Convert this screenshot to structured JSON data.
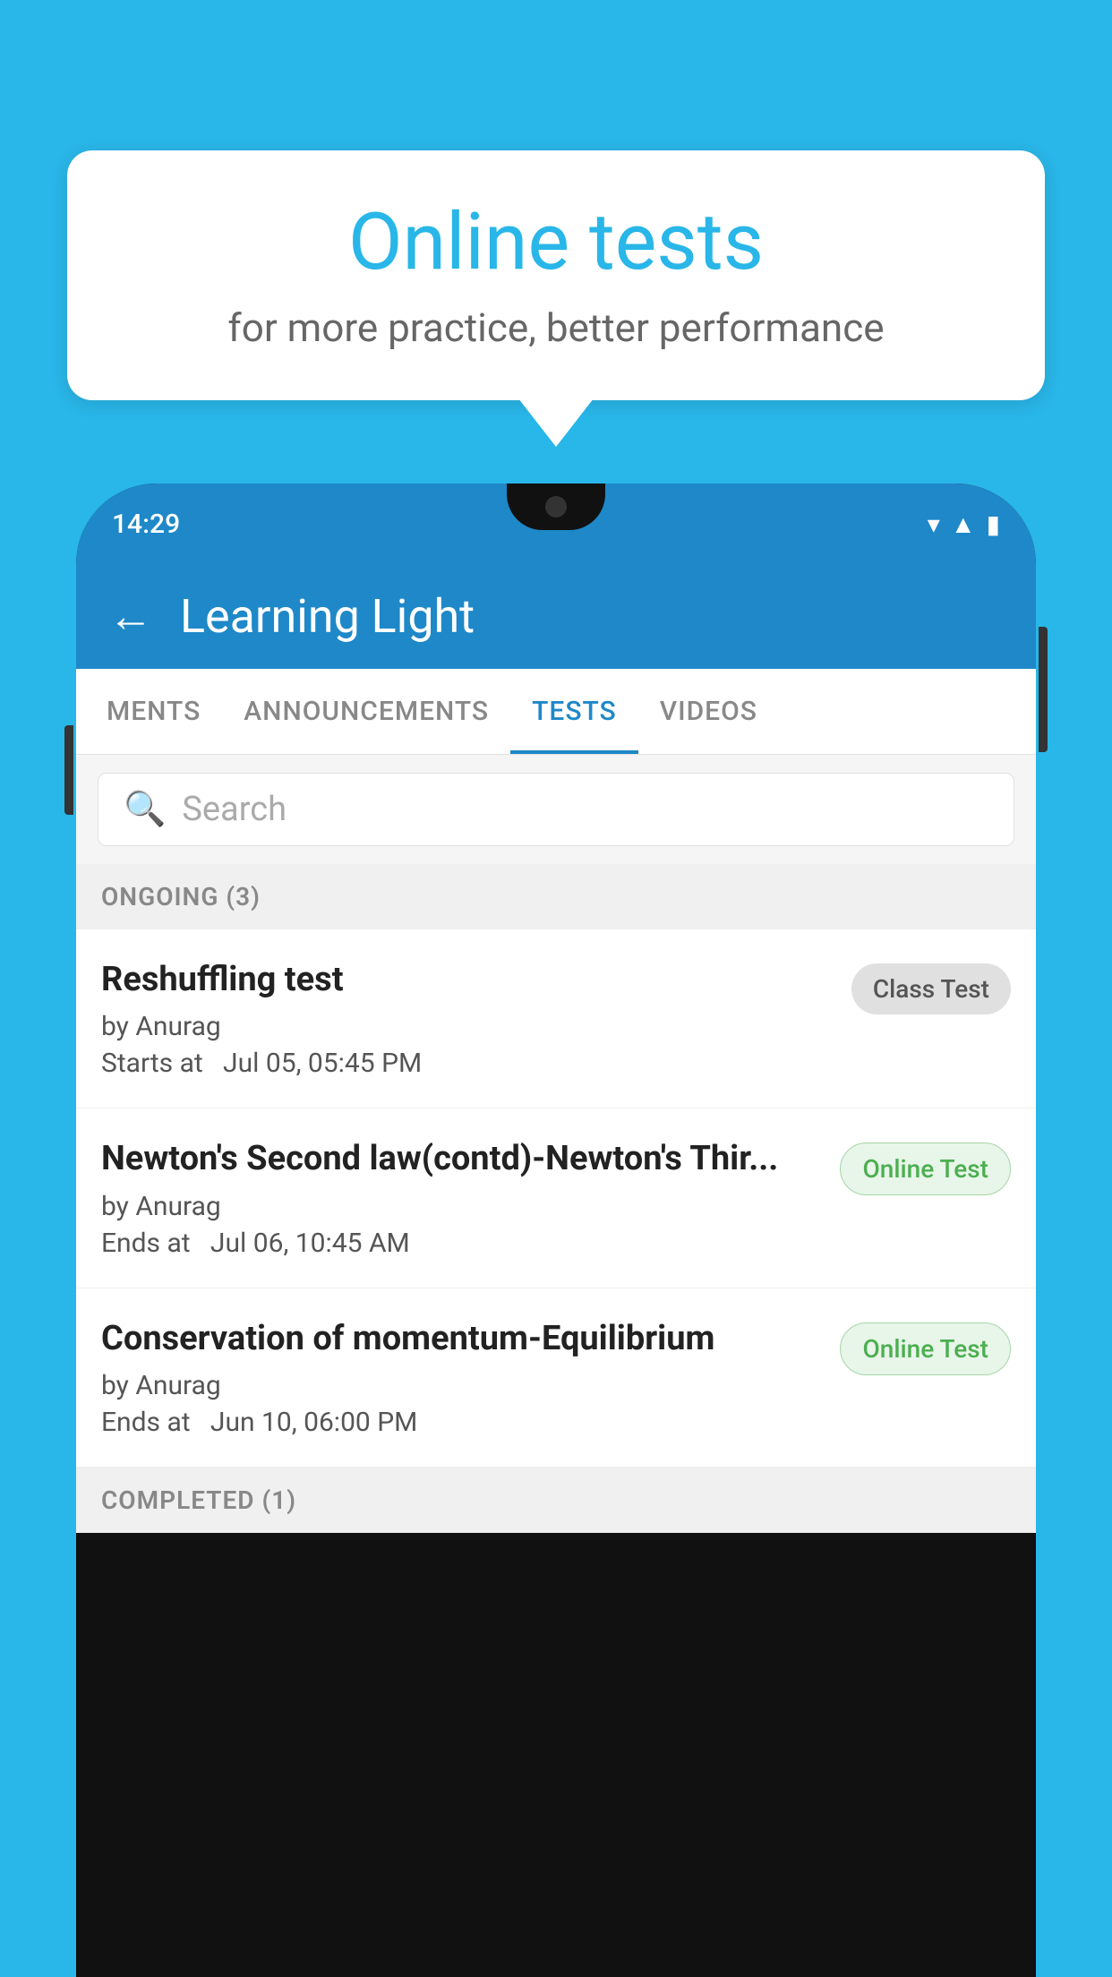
{
  "background_color": "#29b6e8",
  "speech_bubble": {
    "title": "Online tests",
    "subtitle": "for more practice, better performance"
  },
  "phone": {
    "status_bar": {
      "time": "14:29",
      "icons": [
        "wifi",
        "signal",
        "battery"
      ]
    },
    "app_header": {
      "title": "Learning Light",
      "back_label": "←"
    },
    "tabs": [
      {
        "label": "MENTS",
        "active": false
      },
      {
        "label": "ANNOUNCEMENTS",
        "active": false
      },
      {
        "label": "TESTS",
        "active": true
      },
      {
        "label": "VIDEOS",
        "active": false
      }
    ],
    "search": {
      "placeholder": "Search"
    },
    "ongoing_section": {
      "label": "ONGOING (3)"
    },
    "test_items": [
      {
        "name": "Reshuffling test",
        "author": "by Anurag",
        "date_label": "Starts at",
        "date": "Jul 05, 05:45 PM",
        "badge": "Class Test",
        "badge_type": "class"
      },
      {
        "name": "Newton's Second law(contd)-Newton's Thir...",
        "author": "by Anurag",
        "date_label": "Ends at",
        "date": "Jul 06, 10:45 AM",
        "badge": "Online Test",
        "badge_type": "online"
      },
      {
        "name": "Conservation of momentum-Equilibrium",
        "author": "by Anurag",
        "date_label": "Ends at",
        "date": "Jun 10, 06:00 PM",
        "badge": "Online Test",
        "badge_type": "online"
      }
    ],
    "completed_section": {
      "label": "COMPLETED (1)"
    }
  }
}
